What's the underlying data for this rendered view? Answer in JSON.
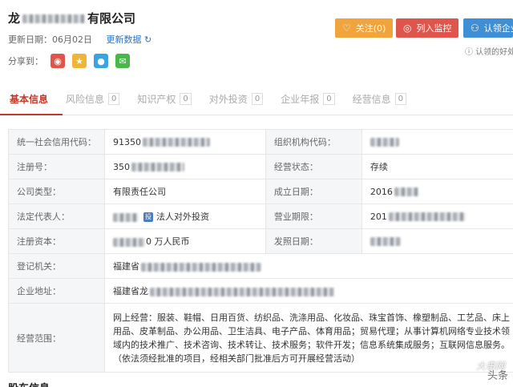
{
  "header": {
    "title_prefix": "龙",
    "title_suffix": "有限公司",
    "update_date": "更新日期：06月02日",
    "refresh_label": "更新数据",
    "share_label": "分享到："
  },
  "actions": {
    "follow": "关注(0)",
    "monitor": "列入监控",
    "claim": "认领企业",
    "claim_note": "认领的好处"
  },
  "tabs": [
    {
      "label": "基本信息",
      "count": ""
    },
    {
      "label": "风险信息",
      "count": "0"
    },
    {
      "label": "知识产权",
      "count": "0"
    },
    {
      "label": "对外投资",
      "count": "0"
    },
    {
      "label": "企业年报",
      "count": "0"
    },
    {
      "label": "经营信息",
      "count": "0"
    }
  ],
  "info": {
    "credit_code_label": "统一社会信用代码：",
    "credit_code_value": "91350",
    "org_code_label": "组织机构代码：",
    "reg_no_label": "注册号：",
    "reg_no_value": "350",
    "status_label": "经营状态：",
    "status_value": "存续",
    "type_label": "公司类型：",
    "type_value": "有限责任公司",
    "est_date_label": "成立日期：",
    "est_date_value": "2016",
    "legal_rep_label": "法定代表人：",
    "legal_rep_link": "法人对外投资",
    "term_label": "营业期限：",
    "term_value": "201",
    "capital_label": "注册资本：",
    "capital_value": "0 万人民币",
    "issue_date_label": "发照日期：",
    "authority_label": "登记机关：",
    "authority_value": "福建省",
    "address_label": "企业地址：",
    "address_value": "福建省龙",
    "scope_label": "经营范围：",
    "scope_value": "网上经营：服装、鞋帽、日用百货、纺织品、洗涤用品、化妆品、珠宝首饰、橡塑制品、工艺品、床上用品、皮革制品、办公用品、卫生洁具、电子产品、体育用品；贸易代理；从事计算机网络专业技术领域内的技术推广、技术咨询、技术转让、技术服务；软件开发；信息系统集成服务；互联网信息服务。（依法须经批准的项目，经相关部门批准后方可开展经营活动）"
  },
  "bottom": {
    "section_title": "股东信息"
  },
  "watermark": {
    "text": "头条",
    "site": "大事网"
  },
  "colors": {
    "accent_red": "#c0392b",
    "follow_orange": "#f0a43b",
    "monitor_red": "#e0554b",
    "claim_blue": "#3f8fd6",
    "link_blue": "#2b74c7"
  }
}
